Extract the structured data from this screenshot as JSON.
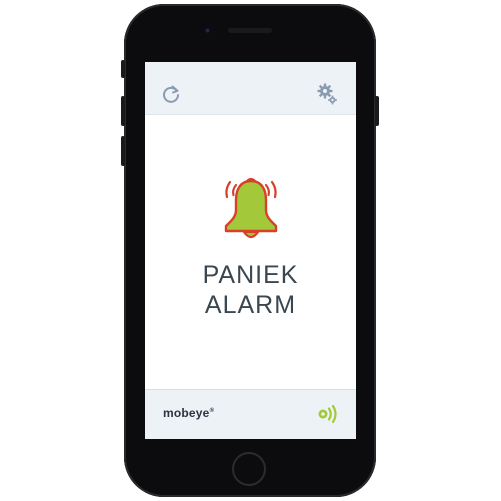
{
  "alarm": {
    "line1": "PANIEK",
    "line2": "ALARM"
  },
  "brand": {
    "name": "mobeye",
    "mark": "®"
  },
  "icons": {
    "refresh": "refresh-icon",
    "settings": "gear-icon",
    "bell": "ringing-bell-icon",
    "wireless": "wireless-signal-icon"
  },
  "colors": {
    "bell_fill": "#a3c93a",
    "bell_outline": "#d8402a",
    "accent_green": "#a3c93a",
    "text": "#3a4750",
    "icon_gray": "#8a9bb0"
  }
}
